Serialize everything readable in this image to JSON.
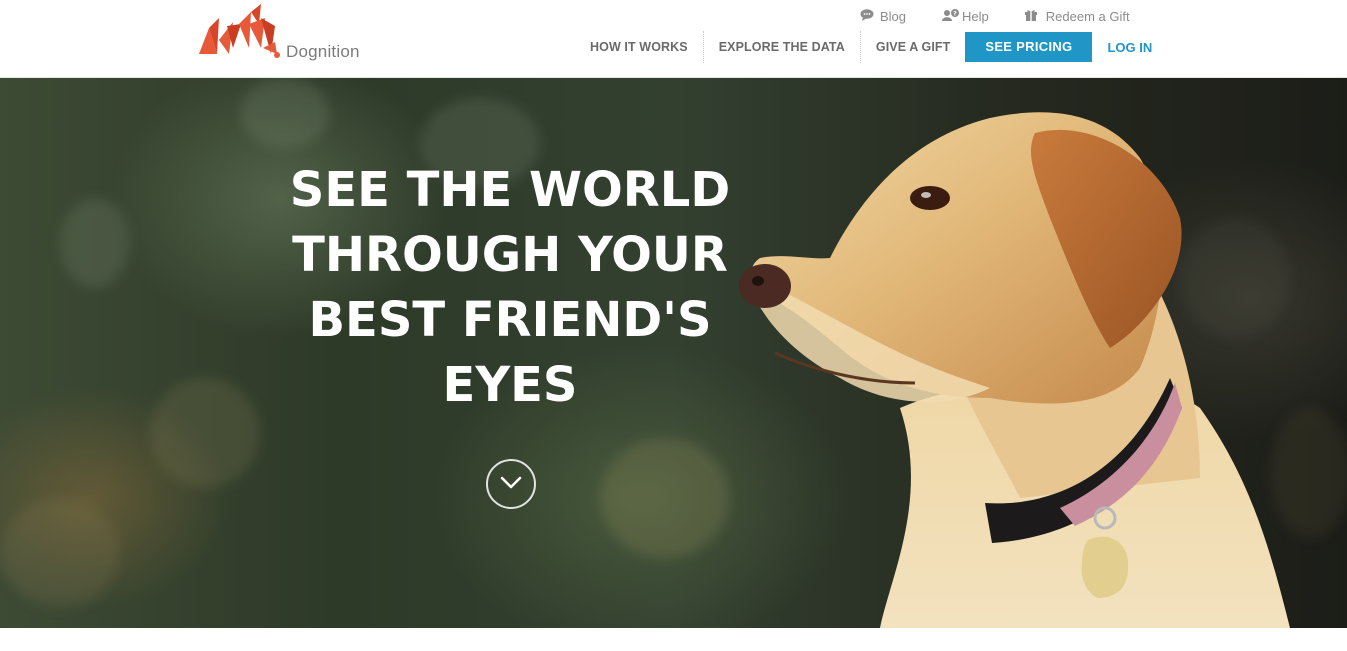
{
  "brand": {
    "name": "Dognition",
    "accent_color": "#e65a3a",
    "link_color": "#1f96c5"
  },
  "utility_nav": [
    {
      "label": "Blog",
      "icon": "chat-bubble-icon"
    },
    {
      "label": "Help",
      "icon": "people-help-icon"
    },
    {
      "label": "Redeem a Gift",
      "icon": "gift-icon"
    }
  ],
  "main_nav": {
    "how_it_works": "HOW IT WORKS",
    "explore_the_data": "EXPLORE THE DATA",
    "give_a_gift": "GIVE A GIFT",
    "see_pricing": "SEE PRICING",
    "log_in": "LOG IN"
  },
  "hero": {
    "headline_lines": [
      "SEE THE WORLD",
      "THROUGH YOUR",
      "BEST FRIEND'S",
      "EYES"
    ],
    "scroll_icon": "chevron-down-circle-icon"
  }
}
